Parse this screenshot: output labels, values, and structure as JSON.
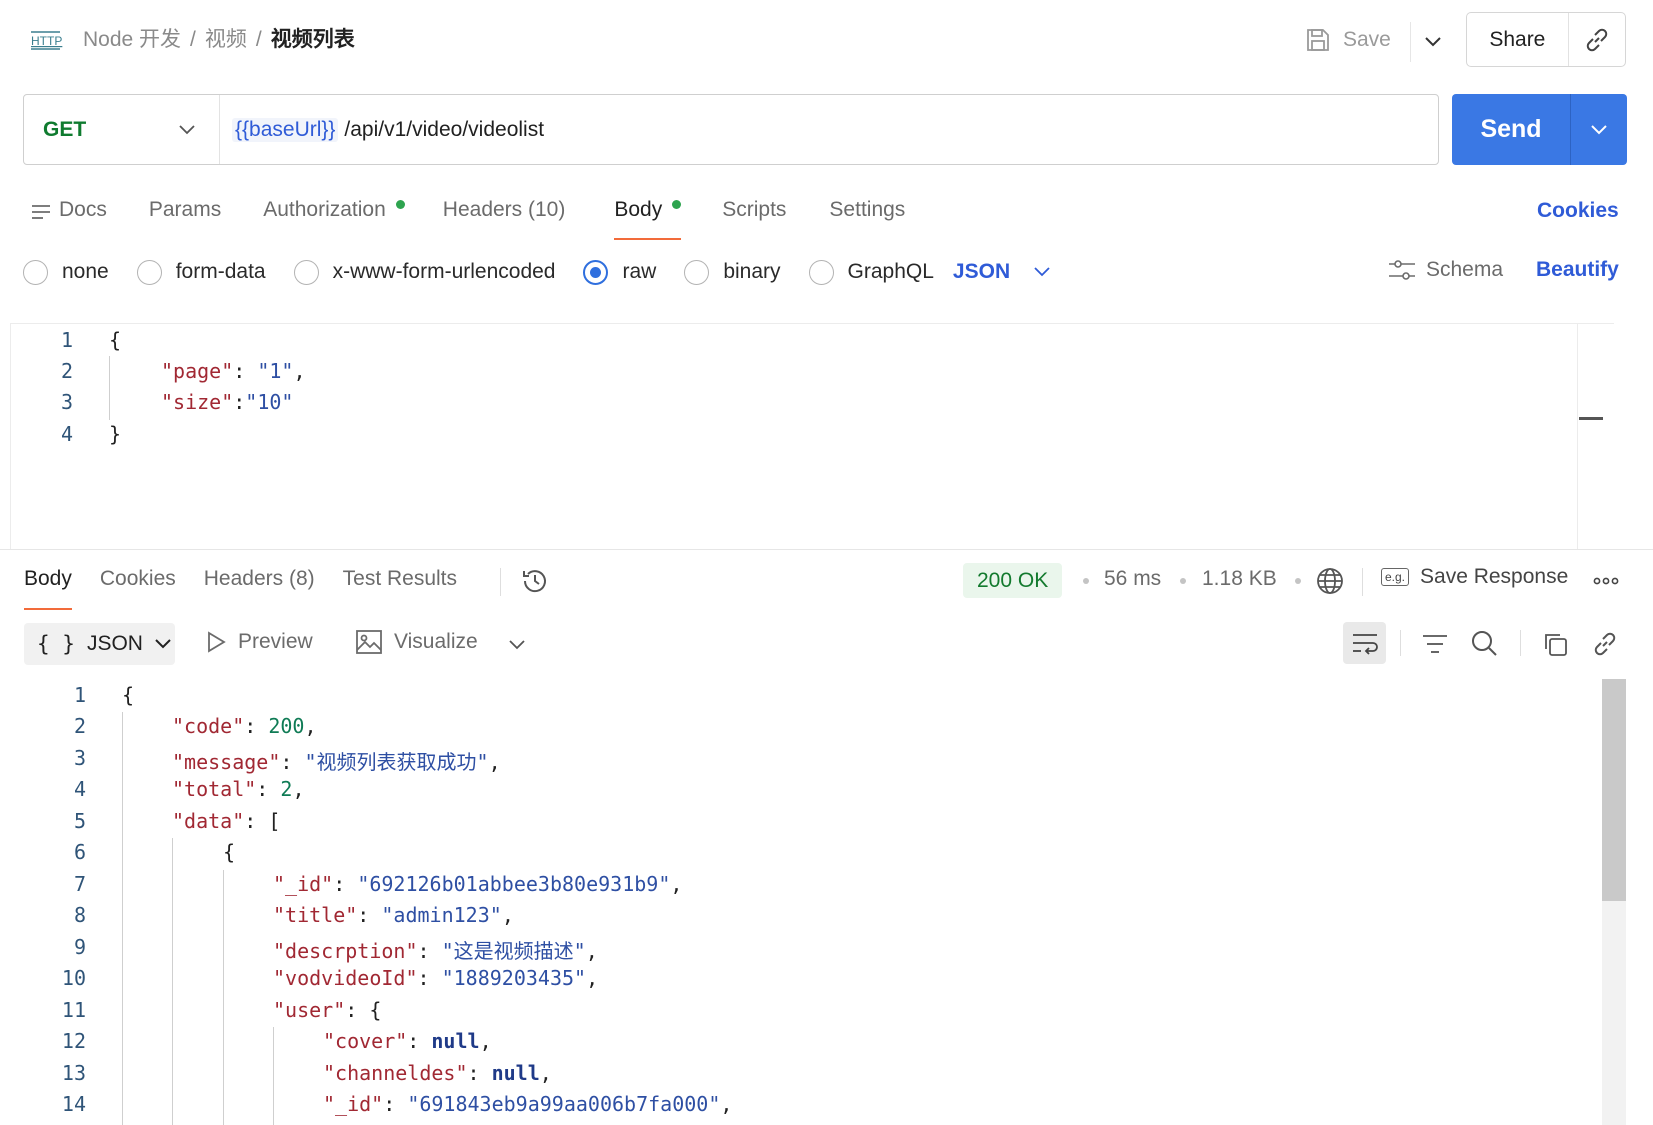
{
  "breadcrumb": {
    "parent1": "Node 开发",
    "parent2": "视频",
    "current": "视频列表",
    "separator": "/"
  },
  "header": {
    "save_label": "Save",
    "share_label": "Share"
  },
  "request": {
    "method": "GET",
    "url_variable": "{{baseUrl}}",
    "url_path": "/api/v1/video/videolist",
    "send_label": "Send"
  },
  "request_tabs": [
    {
      "label": "Docs"
    },
    {
      "label": "Params"
    },
    {
      "label": "Authorization"
    },
    {
      "label": "Headers (10)"
    },
    {
      "label": "Body"
    },
    {
      "label": "Scripts"
    },
    {
      "label": "Settings"
    }
  ],
  "cookies_label": "Cookies",
  "body_types": {
    "none": "none",
    "form_data": "form-data",
    "urlencoded": "x-www-form-urlencoded",
    "raw": "raw",
    "binary": "binary",
    "graphql": "GraphQL",
    "selected_format": "JSON"
  },
  "schema_label": "Schema",
  "beautify_label": "Beautify",
  "request_body": {
    "line_numbers": [
      "1",
      "2",
      "3",
      "4"
    ],
    "l1": "{",
    "l2_key": "\"page\"",
    "l2_val": "\"1\"",
    "l3_key": "\"size\"",
    "l3_val": "\"10\"",
    "l4": "}"
  },
  "response_tabs": [
    {
      "label": "Body"
    },
    {
      "label": "Cookies"
    },
    {
      "label": "Headers (8)"
    },
    {
      "label": "Test Results"
    }
  ],
  "response_meta": {
    "status": "200 OK",
    "time": "56 ms",
    "size": "1.18 KB",
    "save_response": "Save Response",
    "eg_badge": "e.g."
  },
  "response_toolbar": {
    "format": "JSON",
    "format_icon": "{ }",
    "preview": "Preview",
    "visualize": "Visualize"
  },
  "response_body": {
    "line_numbers": [
      "1",
      "2",
      "3",
      "4",
      "5",
      "6",
      "7",
      "8",
      "9",
      "10",
      "11",
      "12",
      "13",
      "14"
    ],
    "code_key": "\"code\"",
    "code_val": "200",
    "message_key": "\"message\"",
    "message_val": "\"视频列表获取成功\"",
    "total_key": "\"total\"",
    "total_val": "2",
    "data_key": "\"data\"",
    "id_key": "\"_id\"",
    "id_val": "\"692126b01abbee3b80e931b9\"",
    "title_key": "\"title\"",
    "title_val": "\"admin123\"",
    "desc_key": "\"descrption\"",
    "desc_val": "\"这是视频描述\"",
    "vod_key": "\"vodvideoId\"",
    "vod_val": "\"1889203435\"",
    "user_key": "\"user\"",
    "cover_key": "\"cover\"",
    "cover_val": "null",
    "chan_key": "\"channeldes\"",
    "chan_val": "null",
    "uid_key": "\"_id\"",
    "uid_val": "\"691843eb9a99aa006b7fa000\""
  }
}
